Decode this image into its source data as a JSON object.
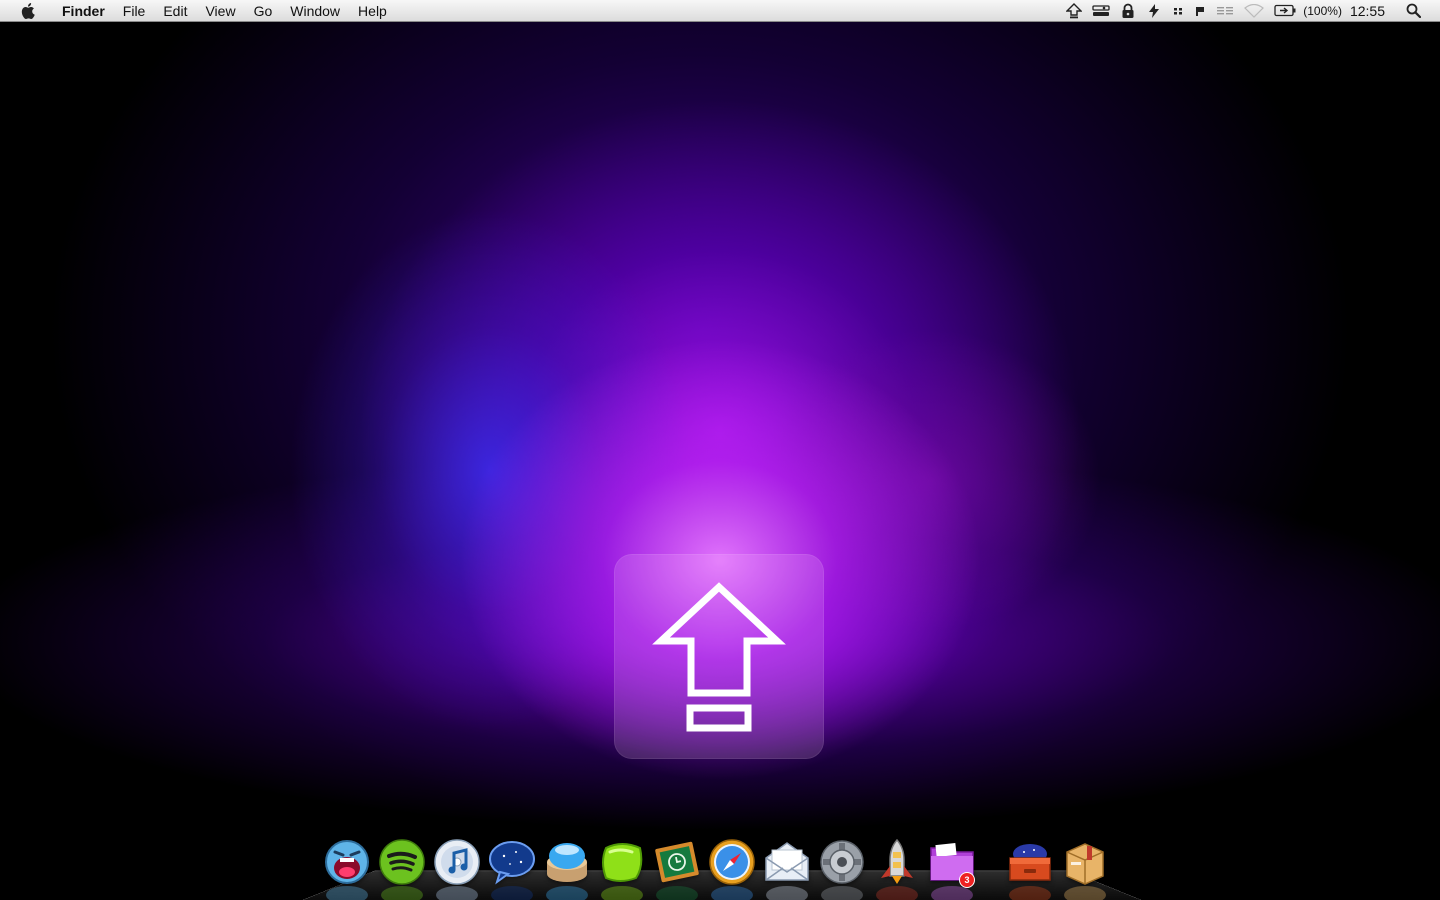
{
  "menubar": {
    "app_name": "Finder",
    "menus": [
      "File",
      "Edit",
      "View",
      "Go",
      "Window",
      "Help"
    ],
    "status": {
      "icons": [
        "upload-icon",
        "toggle-switch-icon",
        "lock-icon",
        "sync-icon",
        "grid-icon",
        "flag-icon",
        "bars-icon",
        "wifi-icon",
        "battery-icon"
      ],
      "battery_text": "(100%)",
      "clock": "12:55"
    }
  },
  "overlay": {
    "icon": "upload-arrow-icon"
  },
  "dock": {
    "items": [
      {
        "name": "dock-app-screaming-face",
        "icon": "screaming-face-icon"
      },
      {
        "name": "dock-app-spotify",
        "icon": "spotify-icon"
      },
      {
        "name": "dock-app-itunes",
        "icon": "itunes-icon"
      },
      {
        "name": "dock-app-chat",
        "icon": "chat-bubble-icon"
      },
      {
        "name": "dock-app-blue-button",
        "icon": "blue-button-icon"
      },
      {
        "name": "dock-app-lime",
        "icon": "lime-icon"
      },
      {
        "name": "dock-app-chalkboard-clock",
        "icon": "chalkboard-clock-icon"
      },
      {
        "name": "dock-app-safari",
        "icon": "compass-icon"
      },
      {
        "name": "dock-app-mail",
        "icon": "envelope-icon"
      },
      {
        "name": "dock-app-system-preferences",
        "icon": "gear-icon"
      },
      {
        "name": "dock-app-rocket",
        "icon": "rocket-icon"
      },
      {
        "name": "dock-app-purple-folder",
        "icon": "purple-folder-icon",
        "badge": "3"
      },
      {
        "name": "dock-app-stack-box",
        "icon": "stack-box-icon"
      },
      {
        "name": "dock-app-package",
        "icon": "package-icon"
      }
    ]
  },
  "colors": {
    "menubar_top": "#f7f7f7",
    "menubar_bottom": "#dcdcdc",
    "wallpaper_glow": "#c040ff",
    "wallpaper_blue": "#3c32ff"
  }
}
